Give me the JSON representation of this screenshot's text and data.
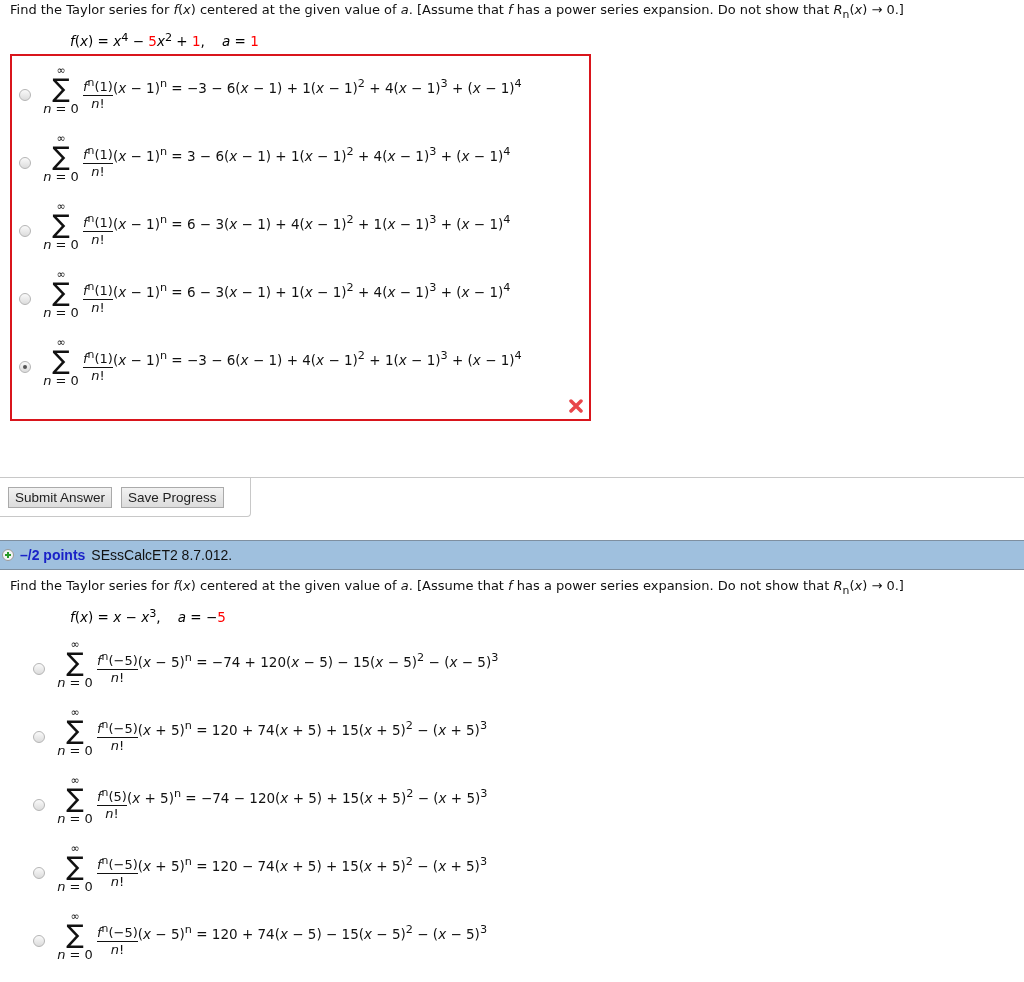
{
  "questions": [
    {
      "instruction": "Find the Taylor series for *f*(*x*) centered at the given value of *a*. [Assume that *f* has a power series expansion. Do not show that  *R*$_{n}$(*x*) → 0.]",
      "function": [
        {
          "text": "*f*(*x*) = *x*$^{4}$ − ",
          "color": "#000000"
        },
        {
          "text": "5",
          "color": "#ff0000"
        },
        {
          "text": "*x*$^{2}$ + ",
          "color": "#000000"
        },
        {
          "text": "1",
          "color": "#ff0000"
        },
        {
          "text": ",    *a* = ",
          "color": "#000000"
        },
        {
          "text": "1",
          "color": "#ff0000"
        }
      ],
      "incorrect": true,
      "options": [
        {
          "selected": false,
          "upper": "∞",
          "sigma": "∑",
          "lower": "*n* = 0",
          "numerator": "*f*$^{n}$(1)",
          "denominator": "*n*!",
          "expression": "(*x* − 1)$^{n}$ = −3 − 6(*x* − 1) + 1(*x* − 1)$^{2}$ + 4(*x* − 1)$^{3}$ + (*x* − 1)$^{4}$"
        },
        {
          "selected": false,
          "upper": "∞",
          "sigma": "∑",
          "lower": "*n* = 0",
          "numerator": "*f*$^{n}$(1)",
          "denominator": "*n*!",
          "expression": "(*x* − 1)$^{n}$ = 3 − 6(*x* − 1) + 1(*x* − 1)$^{2}$ + 4(*x* − 1)$^{3}$ + (*x* − 1)$^{4}$"
        },
        {
          "selected": false,
          "upper": "∞",
          "sigma": "∑",
          "lower": "*n* = 0",
          "numerator": "*f*$^{n}$(1)",
          "denominator": "*n*!",
          "expression": "(*x* − 1)$^{n}$ = 6 − 3(*x* − 1) + 4(*x* − 1)$^{2}$ + 1(*x* − 1)$^{3}$ + (*x* − 1)$^{4}$"
        },
        {
          "selected": false,
          "upper": "∞",
          "sigma": "∑",
          "lower": "*n* = 0",
          "numerator": "*f*$^{n}$(1)",
          "denominator": "*n*!",
          "expression": "(*x* − 1)$^{n}$ = 6 − 3(*x* − 1) + 1(*x* − 1)$^{2}$ + 4(*x* − 1)$^{3}$ + (*x* − 1)$^{4}$"
        },
        {
          "selected": true,
          "upper": "∞",
          "sigma": "∑",
          "lower": "*n* = 0",
          "numerator": "*f*$^{n}$(1)",
          "denominator": "*n*!",
          "expression": "(*x* − 1)$^{n}$ = −3 − 6(*x* − 1) + 4(*x* − 1)$^{2}$ + 1(*x* − 1)$^{3}$ + (*x* − 1)$^{4}$"
        }
      ],
      "buttons": [
        "Submit Answer",
        "Save Progress"
      ]
    },
    {
      "header": {
        "points": "–/2 points",
        "code": "SEssCalcET2 8.7.012."
      },
      "instruction": "Find the Taylor series for *f*(*x*) centered at the given value of *a*. [Assume that *f* has a power series expansion. Do not show that *R*$_{n}$(*x*) → 0.]",
      "function": [
        {
          "text": "*f*(*x*) = *x* − *x*$^{3}$,    *a* = −",
          "color": "#000000"
        },
        {
          "text": "5",
          "color": "#ff0000"
        }
      ],
      "incorrect": false,
      "options": [
        {
          "selected": false,
          "upper": "∞",
          "sigma": "∑",
          "lower": "*n* = 0",
          "numerator": "*f*$^{n}$(−5)",
          "denominator": "*n*!",
          "expression": "(*x* − 5)$^{n}$ = −74 + 120(*x* − 5) − 15(*x* − 5)$^{2}$ − (*x* − 5)$^{3}$"
        },
        {
          "selected": false,
          "upper": "∞",
          "sigma": "∑",
          "lower": "*n* = 0",
          "numerator": "*f*$^{n}$(−5)",
          "denominator": "*n*!",
          "expression": "(*x* + 5)$^{n}$ = 120 + 74(*x* + 5) + 15(*x* + 5)$^{2}$ − (*x* + 5)$^{3}$"
        },
        {
          "selected": false,
          "upper": "∞",
          "sigma": "∑",
          "lower": "*n* = 0",
          "numerator": "*f*$^{n}$(5)",
          "denominator": "*n*!",
          "expression": "(*x* + 5)$^{n}$ = −74 − 120(*x* + 5) + 15(*x* + 5)$^{2}$ − (*x* + 5)$^{3}$"
        },
        {
          "selected": false,
          "upper": "∞",
          "sigma": "∑",
          "lower": "*n* = 0",
          "numerator": "*f*$^{n}$(−5)",
          "denominator": "*n*!",
          "expression": "(*x* + 5)$^{n}$ = 120 − 74(*x* + 5) + 15(*x* + 5)$^{2}$ − (*x* + 5)$^{3}$"
        },
        {
          "selected": false,
          "upper": "∞",
          "sigma": "∑",
          "lower": "*n* = 0",
          "numerator": "*f*$^{n}$(−5)",
          "denominator": "*n*!",
          "expression": "(*x* − 5)$^{n}$ = 120 + 74(*x* − 5) − 15(*x* − 5)$^{2}$ − (*x* − 5)$^{3}$"
        }
      ]
    }
  ]
}
